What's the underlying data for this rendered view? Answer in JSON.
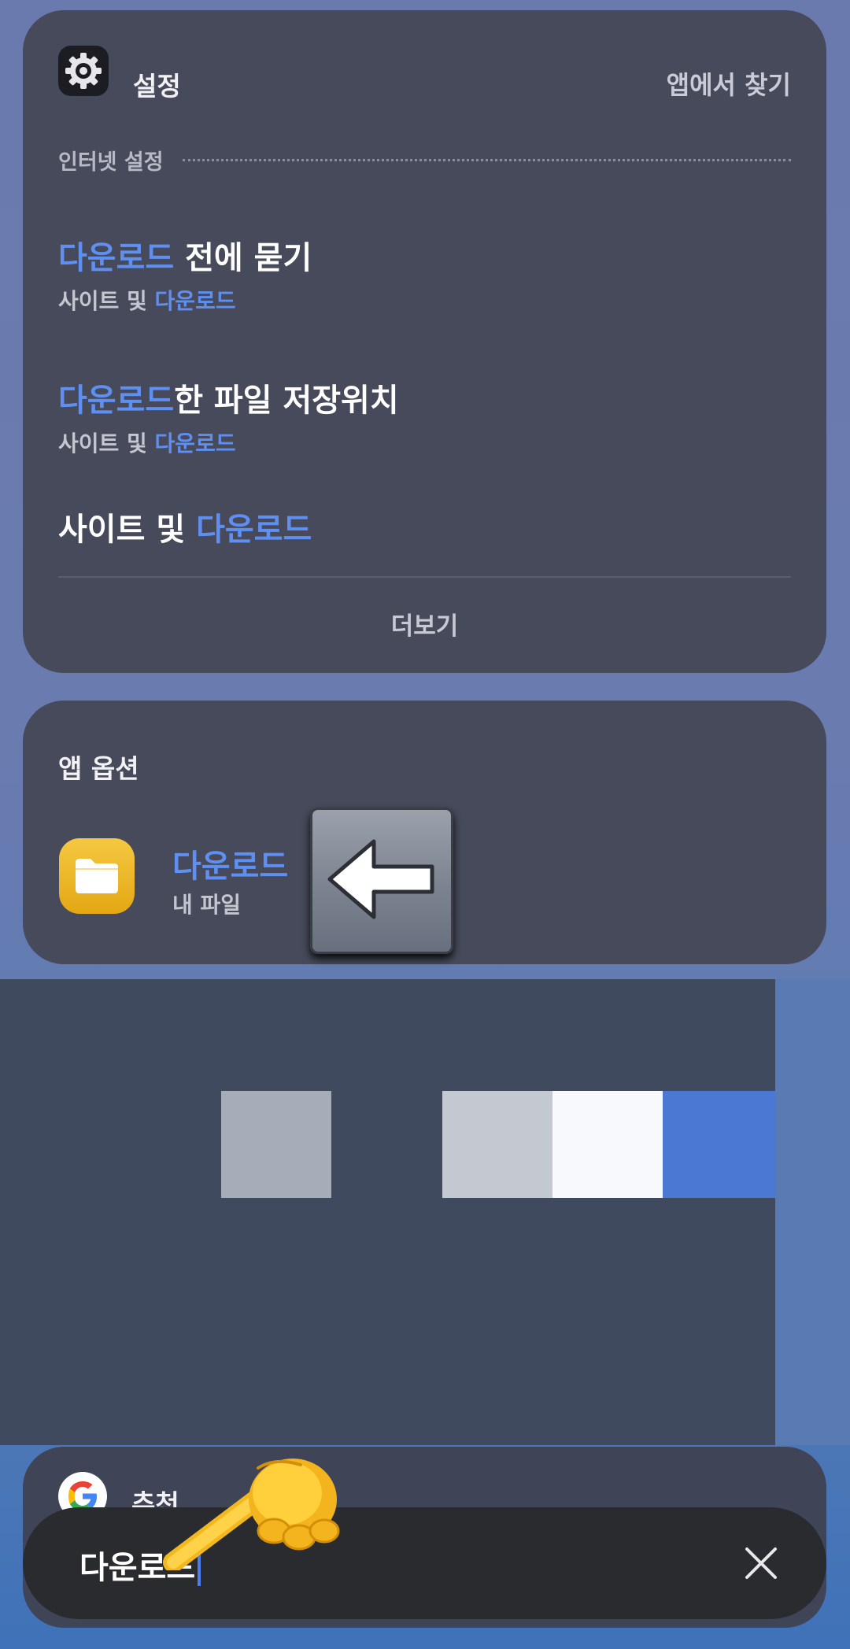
{
  "settings_card": {
    "app_title": "설정",
    "find_in_app": "앱에서 찾기",
    "section_label": "인터넷 설정",
    "results": [
      {
        "title_highlight": "다운로드",
        "title_rest": " 전에 묻기",
        "sub_prefix": "사이트 및 ",
        "sub_highlight": "다운로드"
      },
      {
        "title_highlight": "다운로드",
        "title_rest": "한 파일 저장위치",
        "sub_prefix": "사이트 및 ",
        "sub_highlight": "다운로드"
      },
      {
        "title_prefix": "사이트 및 ",
        "title_highlight": "다운로드"
      }
    ],
    "more": "더보기"
  },
  "app_options_card": {
    "title": "앱 옵션",
    "item_title": "다운로드",
    "item_sub": "내 파일"
  },
  "recommendations_card": {
    "title": "추천"
  },
  "search_bar": {
    "query": "다운로드"
  },
  "colors": {
    "highlight": "#5f8ff0",
    "card_bg": "#464a5a",
    "search_bg": "#2a2b2e"
  }
}
